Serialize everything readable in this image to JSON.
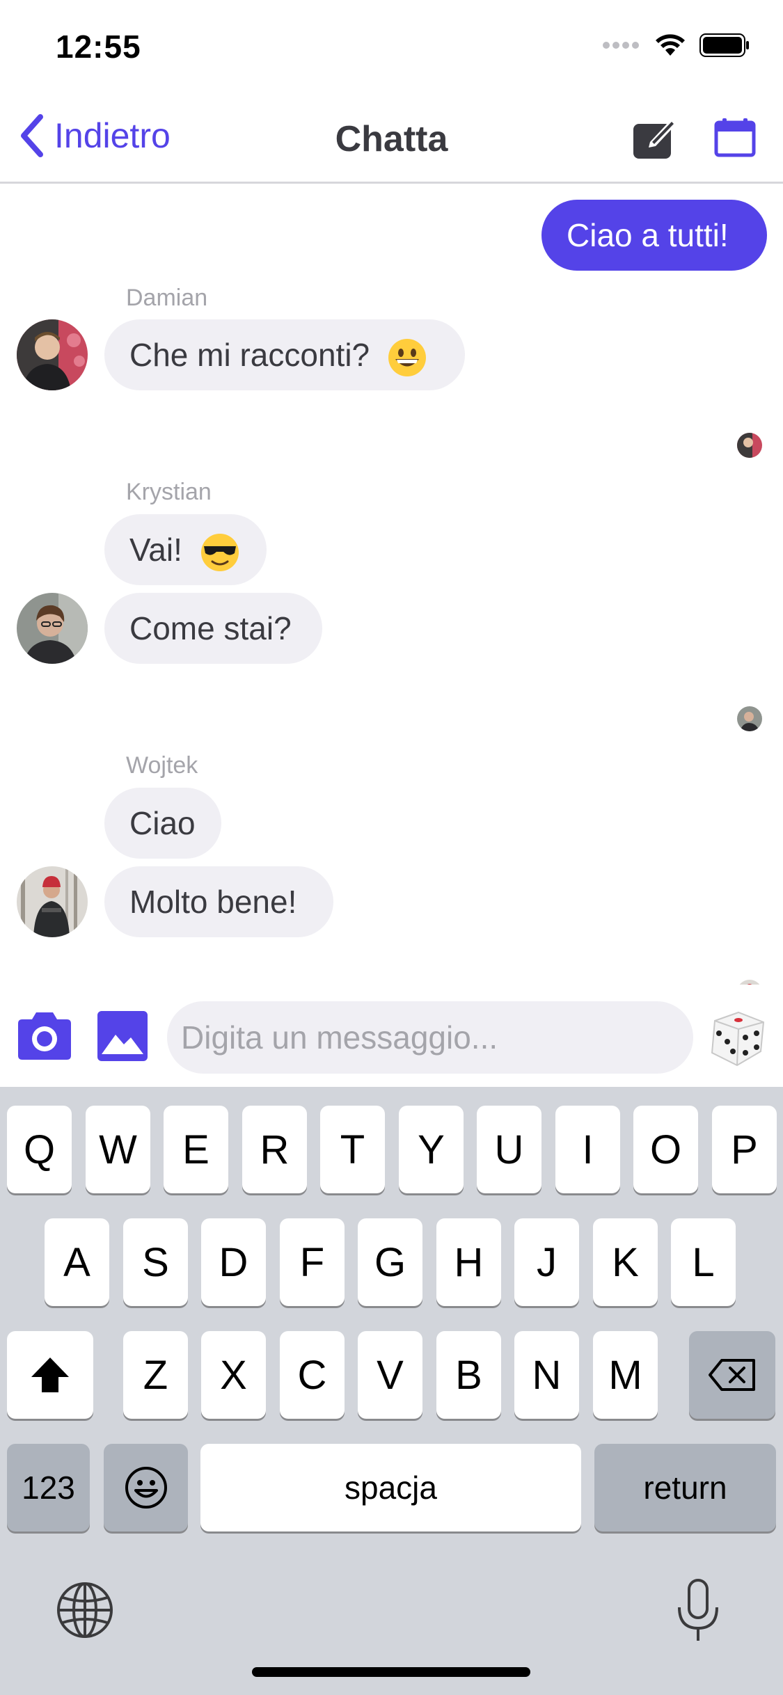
{
  "status_bar": {
    "time": "12:55",
    "icons": [
      "signal-icon",
      "wifi-icon",
      "battery-icon"
    ]
  },
  "nav": {
    "back_label": "Indietro",
    "title": "Chatta",
    "actions": [
      "compose-icon",
      "calendar-icon"
    ]
  },
  "colors": {
    "accent": "#5443e8",
    "incoming_bubble": "#f0eff4",
    "keyboard_bg": "#d2d5db"
  },
  "messages": {
    "outgoing_1": "Ciao a tutti!",
    "damian": {
      "name": "Damian",
      "text_1": "Che mi racconti?"
    },
    "krystian": {
      "name": "Krystian",
      "text_1": "Vai!",
      "text_2": "Come stai?"
    },
    "wojtek": {
      "name": "Wojtek",
      "text_1": "Ciao",
      "text_2": "Molto bene!"
    }
  },
  "composer": {
    "placeholder": "Digita un messaggio...",
    "icons": [
      "camera-icon",
      "image-icon",
      "dice-icon"
    ]
  },
  "keyboard": {
    "row1": [
      "Q",
      "W",
      "E",
      "R",
      "T",
      "Y",
      "U",
      "I",
      "O",
      "P"
    ],
    "row2": [
      "A",
      "S",
      "D",
      "F",
      "G",
      "H",
      "J",
      "K",
      "L"
    ],
    "row3": [
      "Z",
      "X",
      "C",
      "V",
      "B",
      "N",
      "M"
    ],
    "numbers_key": "123",
    "space_key": "spacja",
    "return_key": "return"
  }
}
